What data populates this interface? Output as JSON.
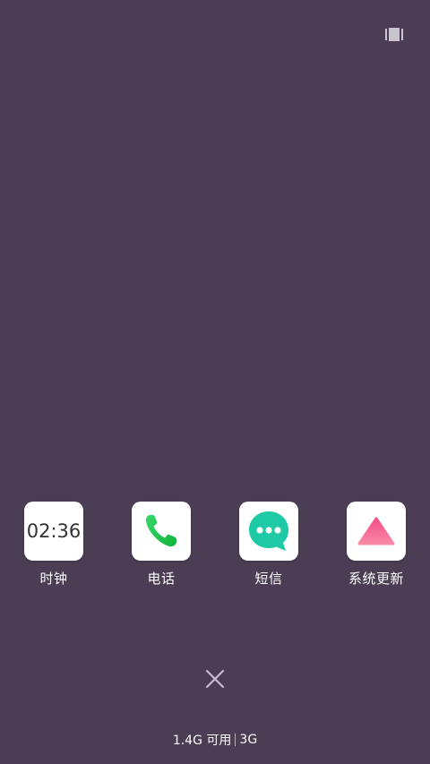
{
  "apps": [
    {
      "id": "clock",
      "label": "时钟",
      "icon": "clock-icon",
      "time": "02:36"
    },
    {
      "id": "phone",
      "label": "电话",
      "icon": "phone-icon",
      "color": "#1fc74a"
    },
    {
      "id": "messages",
      "label": "短信",
      "icon": "messages-icon",
      "color": "#1dcaa5"
    },
    {
      "id": "system-update",
      "label": "系统更新",
      "icon": "update-icon",
      "color": "#f56f96"
    }
  ],
  "memory": {
    "available": "1.4G 可用",
    "total": "3G"
  },
  "colors": {
    "background": "#4a3d54"
  }
}
